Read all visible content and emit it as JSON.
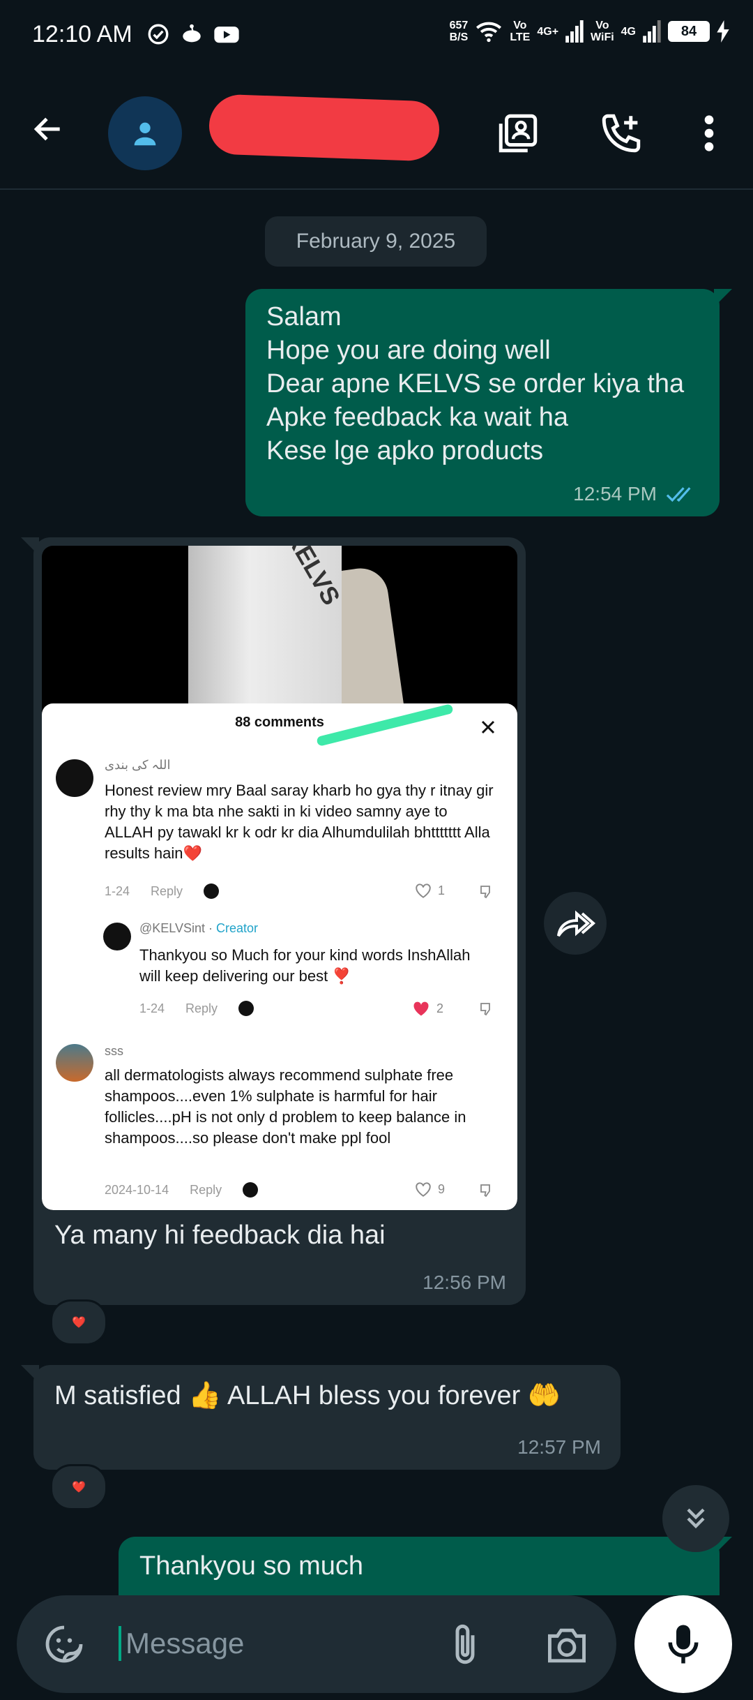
{
  "status_bar": {
    "time": "12:10 AM",
    "net_speed_value": "657",
    "net_speed_unit": "B/S",
    "volte_top": "Vo",
    "volte_bottom": "LTE",
    "sim1": "4G+",
    "vowifi_top": "Vo",
    "vowifi_bottom": "WiFi",
    "sim2": "4G",
    "battery": "84",
    "icons": [
      "check-circle-icon",
      "reddit-icon",
      "youtube-icon",
      "wifi-icon",
      "signal-icon",
      "charging-icon"
    ]
  },
  "header": {
    "contact_name": "",
    "icons": [
      "back-arrow-icon",
      "person-icon",
      "contact-card-icon",
      "add-call-icon",
      "more-vert-icon"
    ]
  },
  "chat": {
    "date_chip": "February 9, 2025",
    "msg1": {
      "text": "Salam\nHope you are doing well\nDear apne KELVS se order kiya tha\nApke feedback ka wait ha\nKese lge apko products",
      "time": "12:54 PM"
    },
    "msg2": {
      "caption": "Ya many hi feedback dia hai",
      "time": "12:56 PM",
      "reaction": "❤️",
      "screenshot": {
        "product_brand": "KELVS",
        "comments_title": "88 comments",
        "comment1": {
          "user": "اللہ کی بندی",
          "text": "Honest review mry Baal saray kharb ho gya thy r itnay gir rhy thy k ma bta nhe sakti in ki video samny aye to ALLAH py tawakl kr k odr kr dia Alhumdulilah bhttttttt Alla results hain❤️",
          "date": "1-24",
          "reply": "Reply",
          "likes": "1"
        },
        "reply1": {
          "user": "@KELVSint",
          "sep": " · ",
          "badge": "Creator",
          "text": "Thankyou so Much for your kind words InshAllah will keep delivering our best ❣️",
          "date": "1-24",
          "reply": "Reply",
          "likes": "2"
        },
        "comment2": {
          "user": "sss",
          "text": "all dermatologists always recommend sulphate free shampoos....even 1% sulphate is harmful for hair follicles....pH is not only d problem to keep balance in shampoos....so please don't make ppl fool",
          "date": "2024-10-14",
          "reply": "Reply",
          "likes": "9"
        }
      }
    },
    "msg3": {
      "text": "M satisfied 👍 ALLAH bless you forever 🤲",
      "time": "12:57 PM",
      "reaction": "❤️"
    },
    "msg4": {
      "text": "Thankyou so much"
    }
  },
  "composer": {
    "placeholder": "Message",
    "icons": [
      "sticker-icon",
      "attach-icon",
      "camera-icon",
      "mic-icon"
    ]
  },
  "colors": {
    "background": "#0b141a",
    "outgoing_bubble": "#005c4b",
    "incoming_bubble": "#202c33",
    "read_ticks": "#53bdeb",
    "accent": "#00a884"
  }
}
